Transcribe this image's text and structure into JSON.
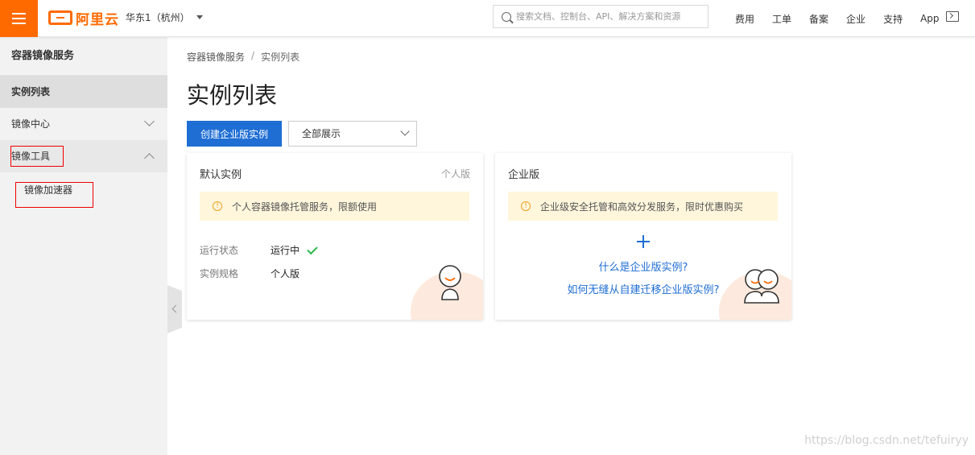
{
  "header": {
    "logo_text": "阿里云",
    "region": "华东1（杭州）",
    "search_placeholder": "搜索文档、控制台、API、解决方案和资源",
    "nav": [
      "费用",
      "工单",
      "备案",
      "企业",
      "支持",
      "App"
    ]
  },
  "sidebar": {
    "title": "容器镜像服务",
    "items": [
      {
        "label": "实例列表",
        "state": "active"
      },
      {
        "label": "镜像中心",
        "state": "collapsed"
      },
      {
        "label": "镜像工具",
        "state": "expanded"
      }
    ],
    "sub_items": [
      {
        "label": "镜像加速器"
      }
    ]
  },
  "breadcrumb": {
    "root": "容器镜像服务",
    "separator": "/",
    "current": "实例列表"
  },
  "page": {
    "title": "实例列表",
    "create_button": "创建企业版实例",
    "filter_select": "全部展示"
  },
  "cards": {
    "default": {
      "title": "默认实例",
      "tag": "个人版",
      "notice": "个人容器镜像托管服务，限额使用",
      "status_label": "运行状态",
      "status_value": "运行中",
      "spec_label": "实例规格",
      "spec_value": "个人版"
    },
    "enterprise": {
      "title": "企业版",
      "notice": "企业级安全托管和高效分发服务，限时优惠购买",
      "link1": "什么是企业版实例?",
      "link2": "如何无缝从自建迁移企业版实例?"
    }
  },
  "watermark": "https://blog.csdn.net/tefuiryy",
  "colors": {
    "brand_orange": "#ff6a00",
    "primary_blue": "#1f6ed4",
    "annotation_red": "#ee0000"
  }
}
